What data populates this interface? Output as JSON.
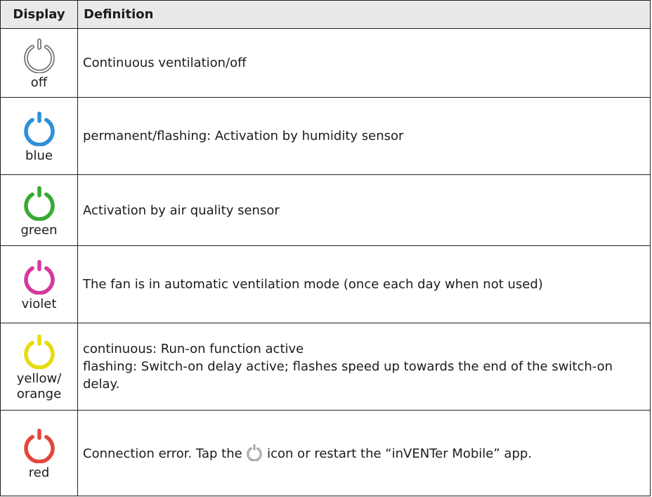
{
  "header": {
    "display": "Display",
    "definition": "Definition"
  },
  "rows": [
    {
      "label": "off",
      "icon": "power-icon",
      "color": "#d9d9d9",
      "definition": "Continuous ventilation/off"
    },
    {
      "label": "blue",
      "icon": "power-icon",
      "color": "#2f8fd8",
      "definition": "permanent/flashing: Activation by humidity sensor"
    },
    {
      "label": "green",
      "icon": "power-icon",
      "color": "#39a935",
      "definition": "Activation by air quality sensor"
    },
    {
      "label": "violet",
      "icon": "power-icon",
      "color": "#d6399b",
      "definition": "The fan is in automatic ventilation mode (once each day when not used)"
    },
    {
      "label_line1": "yellow/",
      "label_line2": "orange",
      "icon": "power-icon",
      "color": "#e6dc10",
      "definition_line1": "continuous: Run-on function active",
      "definition_line2": "flashing: Switch-on delay active; flashes speed up towards the end of the switch-on delay."
    },
    {
      "label": "red",
      "icon": "power-icon",
      "color": "#e2473c",
      "definition_before": "Connection error. Tap the",
      "definition_after": "icon or restart the “inVENTer Mobile” app."
    }
  ]
}
